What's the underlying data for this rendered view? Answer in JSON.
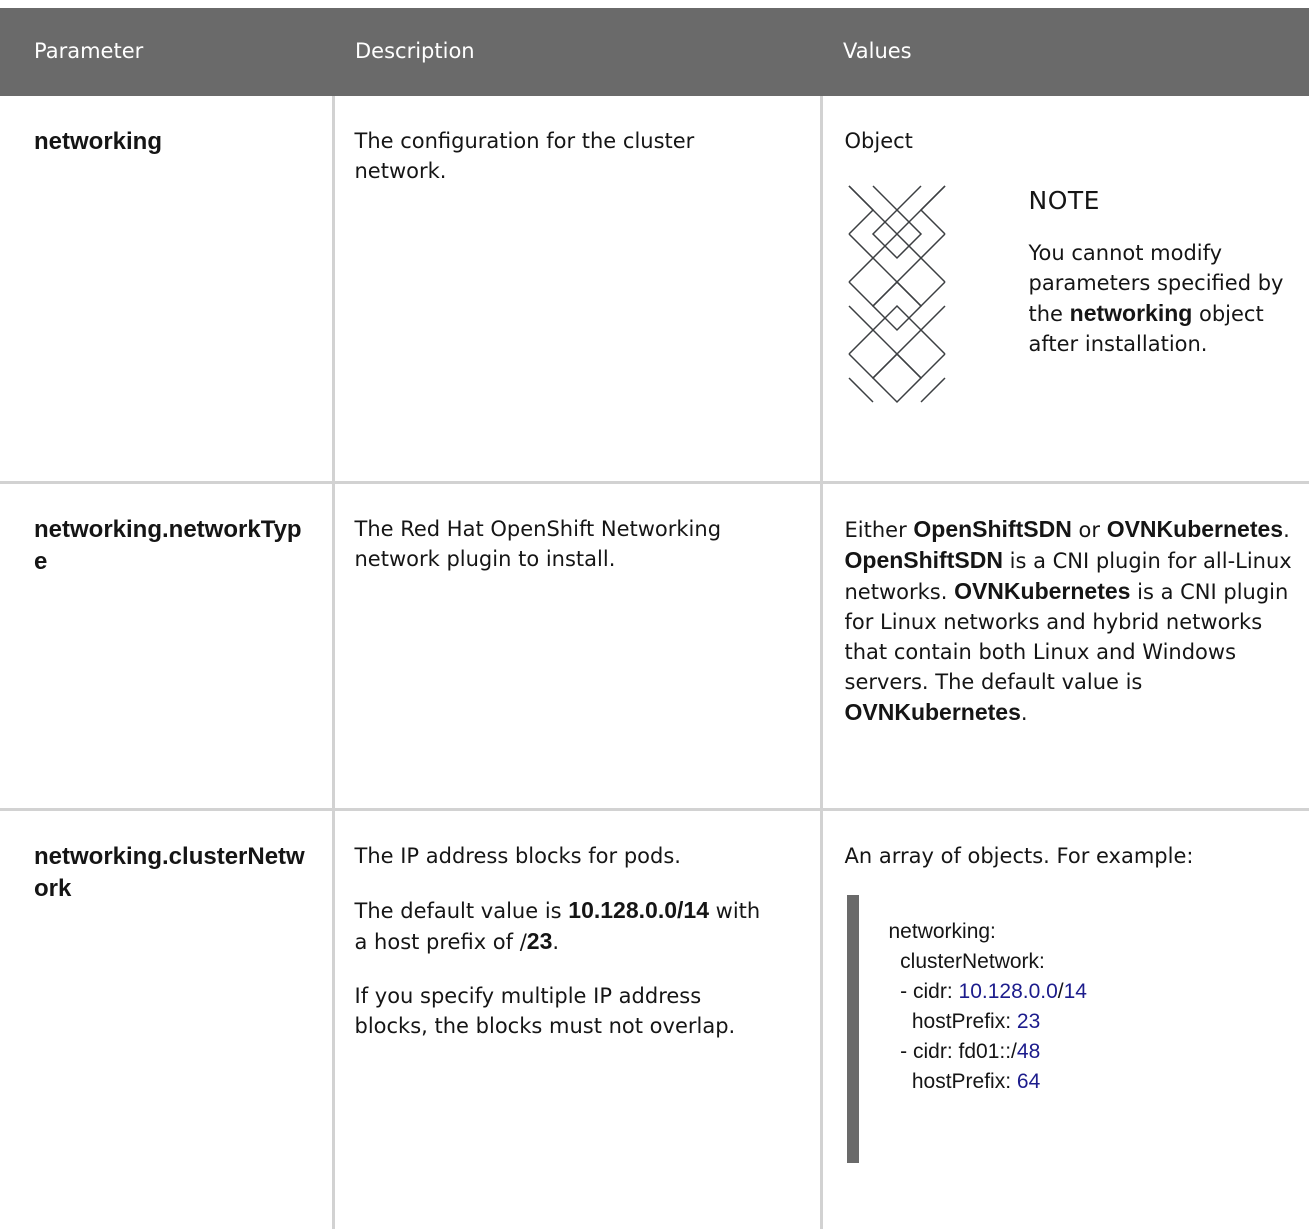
{
  "table": {
    "headers": {
      "parameter": "Parameter",
      "description": "Description",
      "values": "Values"
    },
    "rows": [
      {
        "parameter": "networking",
        "description": "The configuration for the cluster network.",
        "value_intro": "Object",
        "note": {
          "title": "NOTE",
          "text_before": "You cannot modify parameters specified by the ",
          "text_bold": "networking",
          "text_after": " object after installation.",
          "icon": "note-icon"
        }
      },
      {
        "parameter": "networking.networkType",
        "description": "The Red Hat OpenShift Networking network plugin to install.",
        "value": {
          "t1": "Either ",
          "b1": "OpenShiftSDN",
          "t2": " or ",
          "b2": "OVNKubernetes",
          "t3": ". ",
          "b3": "OpenShiftSDN",
          "t4": " is a CNI plugin for all-Linux networks. ",
          "b4": "OVNKubernetes",
          "t5": " is a CNI plugin for Linux networks and hybrid networks that contain both Linux and Windows servers. The default value is ",
          "b5": "OVNKubernetes",
          "t6": "."
        }
      },
      {
        "parameter": "networking.clusterNetwork",
        "description_p1": "The IP address blocks for pods.",
        "description_p2": {
          "t1": "The default value is ",
          "b1": "10.128.0.0/14",
          "t2": " with a host prefix of /",
          "b2": "23",
          "t3": "."
        },
        "description_p3": "If you specify multiple IP address blocks, the blocks must not overlap.",
        "value_intro": "An array of objects. For example:",
        "code": {
          "l1": "networking:",
          "l2": "  clusterNetwork:",
          "l3_key": "  - cidr: ",
          "l3_num": "10.128.0.0",
          "l3_sep": "/",
          "l3_num2": "14",
          "l4_key": "    hostPrefix: ",
          "l4_num": "23",
          "l5_key": "  - cidr: fd01::/",
          "l5_num": "48",
          "l6_key": "    hostPrefix: ",
          "l6_num": "64"
        }
      }
    ]
  },
  "colors": {
    "header_bg": "#6a6a6a",
    "border": "#d2d2d2",
    "code_number": "#1c1c8c"
  }
}
